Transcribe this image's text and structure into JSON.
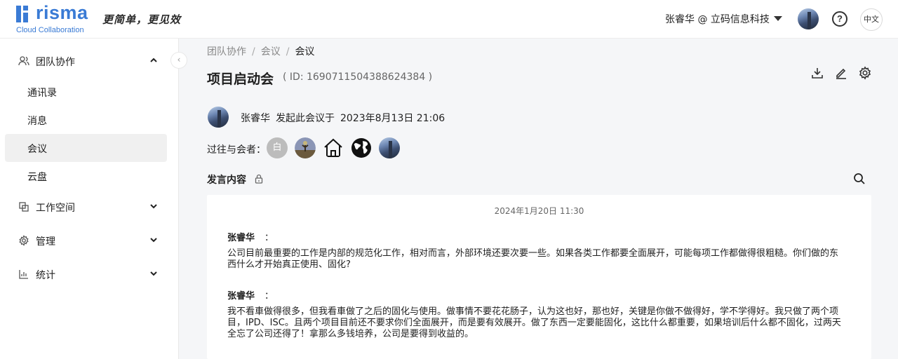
{
  "header": {
    "logo_word": "risma",
    "logo_sub": "Cloud Collaboration",
    "slogan": "更简单，更见效",
    "user_org": "张睿华 @ 立码信息科技",
    "help_symbol": "?",
    "language": "中文"
  },
  "sidebar": {
    "collapse_symbol": "‹",
    "groups": [
      {
        "label": "团队协作",
        "icon": "team-icon",
        "expanded": true
      },
      {
        "label": "工作空间",
        "icon": "workspace-icon",
        "expanded": false
      },
      {
        "label": "管理",
        "icon": "gear-icon",
        "expanded": false
      },
      {
        "label": "统计",
        "icon": "chart-icon",
        "expanded": false
      }
    ],
    "team_items": [
      {
        "label": "通讯录"
      },
      {
        "label": "消息"
      },
      {
        "label": "会议",
        "active": true
      },
      {
        "label": "云盘"
      }
    ]
  },
  "breadcrumb": [
    "团队协作",
    "会议",
    "会议"
  ],
  "breadcrumb_sep": "/",
  "meeting": {
    "title": "项目启动会",
    "id_text": "( ID: 1690711504388624384 )",
    "initiator_name": "张睿华",
    "initiated_label": "发起此会议于",
    "initiated_time": "2023年8月13日 21:06",
    "attendees_label": "过往与会者：",
    "attendee_initial": "白",
    "section_label": "发言内容"
  },
  "transcript": {
    "date": "2024年1月20日 11:30",
    "messages": [
      {
        "speaker": "张睿华",
        "colon": "：",
        "text": "公司目前最重要的工作是内部的规范化工作，相对而言，外部环境还要次要一些。如果各类工作都要全面展开，可能每项工作都做得很粗糙。你们做的东西什么才开始真正使用、固化?"
      },
      {
        "speaker": "张睿华",
        "colon": "：",
        "text": "我不看車做得很多，但我看車做了之后的固化与使用。做事情不要花花肠子，认为这也好，那也好，关键是你做不做得好，学不学得好。我只做了两个项目，IPD、ISC。且两个项目目前还不要求你们全面展开，而是要有效展开。做了东西一定要能固化，这比什么都重要，如果培训后什么都不固化，过两天全忘了公司还得了！拿那么多钱培养，公司是要得到收益的。"
      }
    ]
  },
  "colors": {
    "brand": "#3a7bd5",
    "active_bg": "#f0f0f0"
  }
}
